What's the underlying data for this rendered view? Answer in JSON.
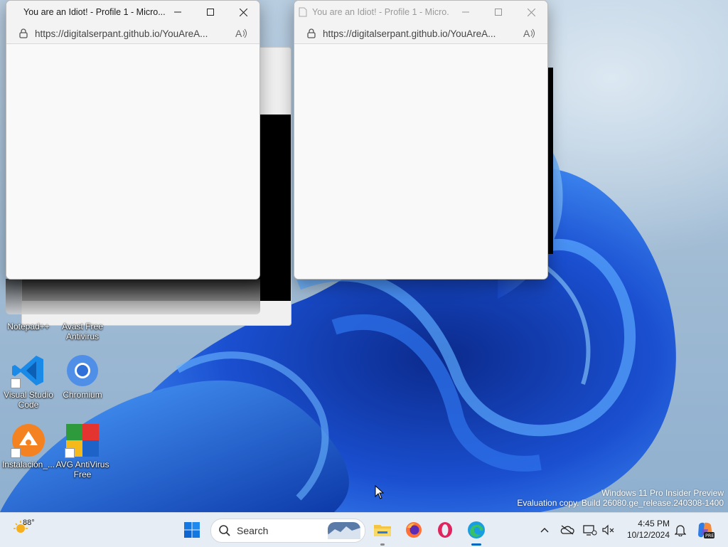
{
  "windows": [
    {
      "title": "You are an Idiot! - Profile 1 - Micro...",
      "url": "https://digitalserpant.github.io/YouAreA...",
      "state": "active"
    },
    {
      "title": "You are an Idiot! - Profile 1 - Micro...",
      "url": "https://digitalserpant.github.io/YouAreA...",
      "state": "inactive"
    }
  ],
  "desktop_icons": [
    {
      "label": "Notepad++",
      "icon": "notepad-plus-plus-icon"
    },
    {
      "label": "Avast Free Antivirus",
      "icon": "avast-icon"
    },
    {
      "label": "Visual Studio Code",
      "icon": "vscode-icon"
    },
    {
      "label": "Chromium",
      "icon": "chromium-icon"
    },
    {
      "label": "Instalación_...",
      "icon": "installer-icon"
    },
    {
      "label": "AVG AntiVirus Free",
      "icon": "avg-icon"
    }
  ],
  "watermark": {
    "line1": "Windows 11 Pro Insider Preview",
    "line2": "Evaluation copy. Build 26080.ge_release.240308-1400"
  },
  "taskbar": {
    "weather_temp": "88°",
    "search_placeholder": "Search",
    "apps": [
      "start-icon",
      "file-explorer-icon",
      "firefox-icon",
      "opera-icon",
      "edge-icon"
    ],
    "time": "4:45 PM",
    "date": "10/12/2024"
  },
  "colors": {
    "taskbar_bg": "#e7edf4",
    "accent": "#0067c0",
    "wallpaper_blue": "#1f5fd6"
  }
}
